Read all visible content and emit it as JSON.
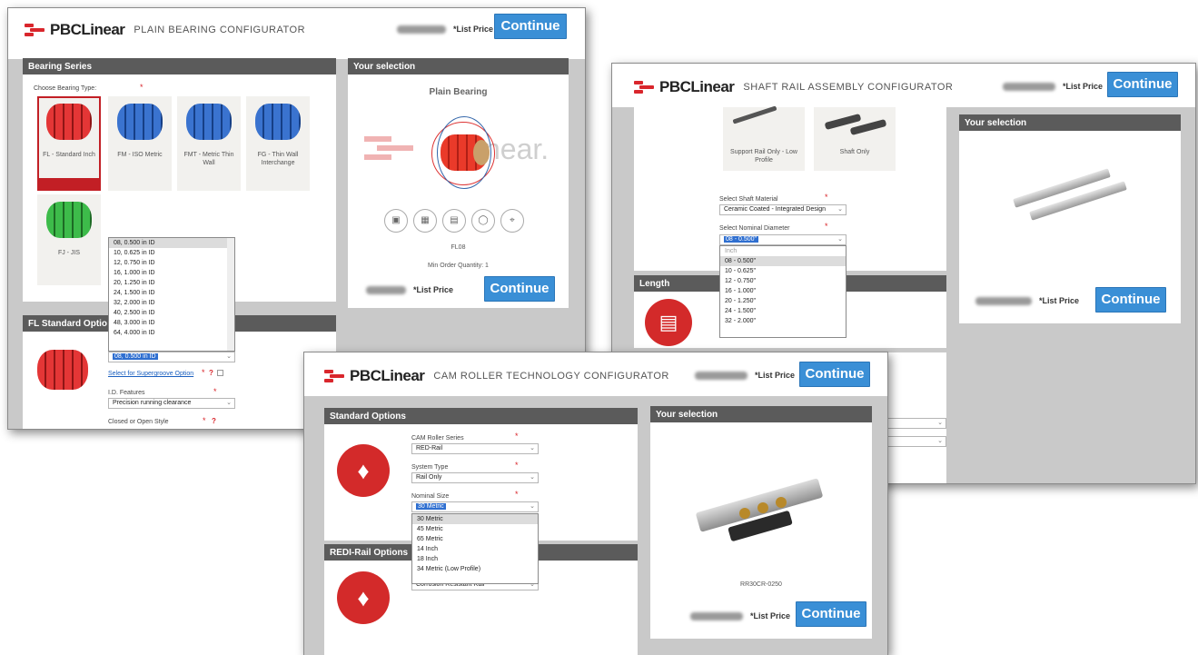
{
  "win1": {
    "brand": "PBCLinear",
    "title": "PLAIN BEARING CONFIGURATOR",
    "price_label": "*List Price",
    "continue_label": "Continue",
    "series_header": "Bearing Series",
    "choose_label": "Choose Bearing Type:",
    "tiles": [
      {
        "caption": "FL - Standard Inch",
        "color": "#d32a2a"
      },
      {
        "caption": "FM - ISO Metric",
        "color": "#2c61b7"
      },
      {
        "caption": "FMT - Metric Thin Wall",
        "color": "#2c61b7"
      },
      {
        "caption": "FG - Thin Wall Interchange",
        "color": "#2c61b7"
      },
      {
        "caption": "FJ - JIS",
        "color": "#2e9a3a"
      }
    ],
    "selection_header": "Your selection",
    "product_title": "Plain Bearing",
    "watermark": "near.",
    "view_icons": [
      "cube-solid-icon",
      "cube-front-icon",
      "cube-wire-icon",
      "lightbulb-icon",
      "dimension-icon"
    ],
    "part_code": "FL08",
    "min_order": "Min Order Quantity: 1",
    "options_header": "FL Standard Optio",
    "id_options": [
      "08, 0.500 in ID",
      "10, 0.625 in ID",
      "12, 0.750 in ID",
      "16, 1.000 in ID",
      "20, 1.250 in ID",
      "24, 1.500 in ID",
      "32, 2.000 in ID",
      "40, 2.500 in ID",
      "48, 3.000 in ID",
      "64, 4.000 in ID"
    ],
    "id_selected": "08, 0.500 in ID",
    "supergroove_link": "Select for Supergroove Option",
    "id_features_label": "I.D. Features",
    "id_features_value": "Precision running clearance",
    "closed_label": "Closed or Open Style"
  },
  "win2": {
    "brand": "PBCLinear",
    "title": "SHAFT RAIL ASSEMBLY CONFIGURATOR",
    "price_label": "*List Price",
    "continue_label": "Continue",
    "tile1": "Support Rail Only - Low Profile",
    "tile2": "Shaft Only",
    "material_label": "Select Shaft Material",
    "material_value": "Ceramic Coated - Integrated Design",
    "diameter_label": "Select Nominal Diameter",
    "diameter_selected": "08 - 0.500\"",
    "diameter_group": "Inch",
    "diameter_options": [
      "08 - 0.500\"",
      "10 - 0.625\"",
      "12 - 0.750\"",
      "16 - 1.000\"",
      "20 - 1.250\"",
      "24 - 1.500\"",
      "32 - 2.000\""
    ],
    "length_header": "Length",
    "selection_header": "Your selection"
  },
  "win3": {
    "brand": "PBCLinear",
    "title": "CAM ROLLER TECHNOLOGY CONFIGURATOR",
    "price_label": "*List Price",
    "continue_label": "Continue",
    "std_header": "Standard Options",
    "series_label": "CAM Roller Series",
    "series_value": "RED-Rail",
    "system_label": "System Type",
    "system_value": "Rail Only",
    "size_label": "Nominal Size",
    "size_selected": "30 Metric",
    "size_options": [
      "30 Metric",
      "45 Metric",
      "65 Metric",
      "14 Inch",
      "18 Inch",
      "34 Metric (Low Profile)"
    ],
    "redi_header": "REDI-Rail Options",
    "redi_value": "Corrosion Resistant Rail",
    "selection_header": "Your selection",
    "part_code": "RR30CR-0250"
  }
}
